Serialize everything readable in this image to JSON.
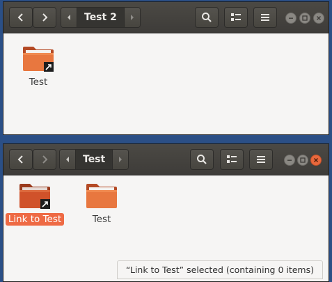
{
  "windows": [
    {
      "path_label": "Test 2",
      "items": [
        {
          "label": "Test",
          "icon": "folder-symlink-icon",
          "selected": false
        }
      ]
    },
    {
      "path_label": "Test",
      "items": [
        {
          "label": "Link to Test",
          "icon": "folder-symlink-icon",
          "selected": true
        },
        {
          "label": "Test",
          "icon": "folder-icon",
          "selected": false
        }
      ],
      "status_text": "“Link to Test” selected  (containing 0 items)"
    }
  ],
  "colors": {
    "header": "#3e3c39",
    "selection": "#ee6a44",
    "folder": "#e8773f",
    "close": "#e9683c",
    "desktop": "#2b4f86"
  }
}
